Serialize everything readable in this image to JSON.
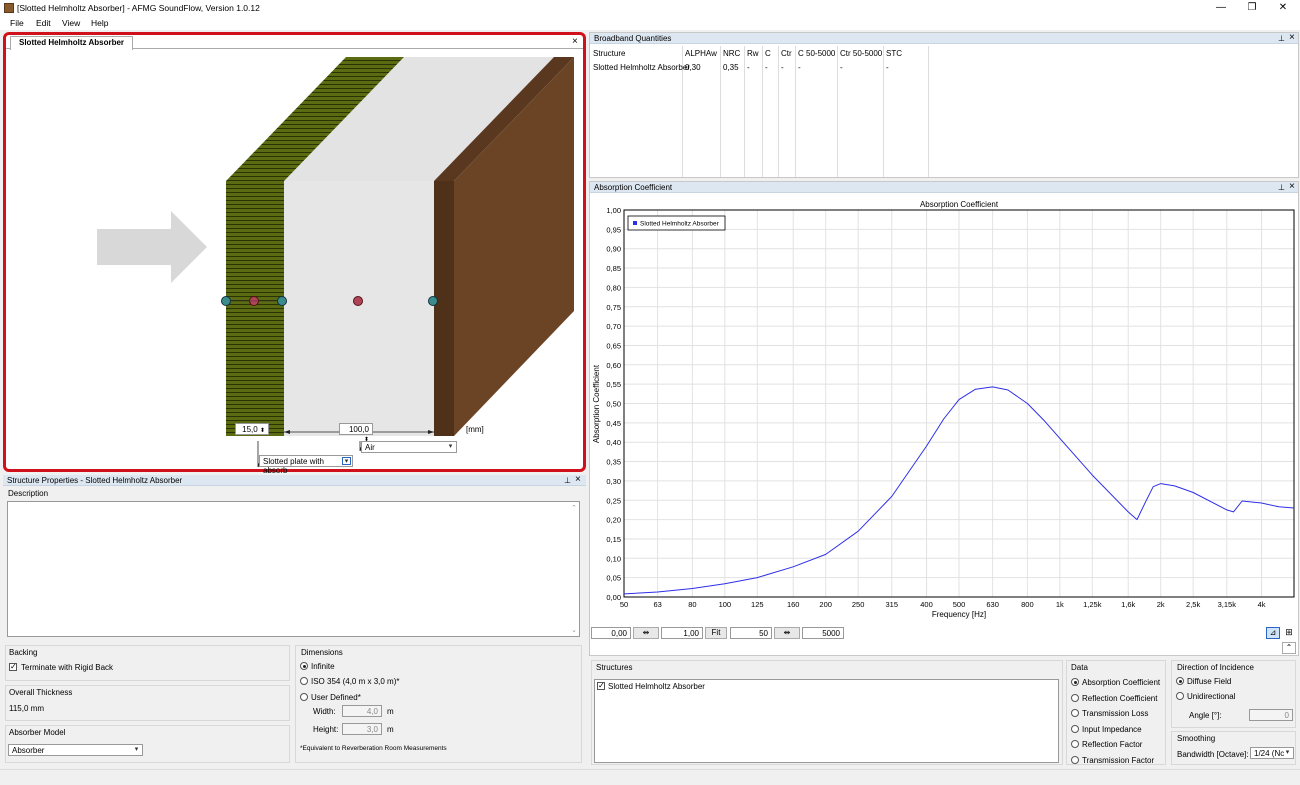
{
  "window": {
    "title": "[Slotted Helmholtz Absorber] - AFMG SoundFlow, Version 1.0.12",
    "minimize": "—",
    "restore": "❐",
    "close": "✕"
  },
  "menu": [
    "File",
    "Edit",
    "View",
    "Help"
  ],
  "editor": {
    "tab_label": "Slotted Helmholtz Absorber",
    "close": "×",
    "thickness1": "15,0",
    "thickness2": "100,0",
    "unit": "[mm]",
    "layer2_material": "Air",
    "layer1_material": "Slotted plate with absorb",
    "colors": {
      "slotted": "#5a6b12",
      "slot_lines": "#2a3306",
      "air": "#e6e6e6",
      "backing": "#6b4426",
      "backing_side": "#4f3019",
      "arrow": "#d8d8d8"
    }
  },
  "broadband": {
    "header": "Broadband Quantities",
    "columns": [
      "Structure",
      "ALPHAw",
      "NRC",
      "Rw",
      "C",
      "Ctr",
      "C 50-5000",
      "Ctr 50-5000",
      "STC"
    ],
    "rows": [
      [
        "Slotted Helmholtz Absorber",
        "0,30",
        "0,35",
        "-",
        "-",
        "-",
        "-",
        "-",
        "-"
      ]
    ]
  },
  "absorption_panel": {
    "header": "Absorption Coefficient"
  },
  "chart_data": {
    "type": "line",
    "title": "Absorption Coefficient",
    "xlabel": "Frequency [Hz]",
    "ylabel": "Absorption Coefficient",
    "xscale": "log",
    "xlim": [
      50,
      5000
    ],
    "ylim": [
      0,
      1
    ],
    "grid": true,
    "legend_position": "top-left",
    "x_ticks": [
      "50",
      "63",
      "80",
      "100",
      "125",
      "160",
      "200",
      "250",
      "315",
      "400",
      "500",
      "630",
      "800",
      "1k",
      "1,25k",
      "1,6k",
      "2k",
      "2,5k",
      "3,15k",
      "4k"
    ],
    "y_ticks": [
      "0,00",
      "0,05",
      "0,10",
      "0,15",
      "0,20",
      "0,25",
      "0,30",
      "0,35",
      "0,40",
      "0,45",
      "0,50",
      "0,55",
      "0,60",
      "0,65",
      "0,70",
      "0,75",
      "0,80",
      "0,85",
      "0,90",
      "0,95",
      "1,00"
    ],
    "series": [
      {
        "name": "Slotted Helmholtz Absorber",
        "color": "#2f2fe8",
        "x": [
          50,
          63,
          80,
          100,
          125,
          160,
          200,
          250,
          315,
          400,
          450,
          500,
          560,
          630,
          700,
          800,
          900,
          1000,
          1250,
          1600,
          1700,
          1800,
          1900,
          2000,
          2200,
          2500,
          3150,
          3300,
          3500,
          4000,
          4500,
          5000
        ],
        "y": [
          0.008,
          0.013,
          0.022,
          0.034,
          0.05,
          0.078,
          0.11,
          0.17,
          0.26,
          0.39,
          0.46,
          0.51,
          0.537,
          0.543,
          0.535,
          0.5,
          0.455,
          0.41,
          0.315,
          0.22,
          0.2,
          0.245,
          0.285,
          0.293,
          0.287,
          0.27,
          0.225,
          0.22,
          0.248,
          0.243,
          0.233,
          0.23
        ]
      }
    ]
  },
  "chart_controls": {
    "xmin": "0,00",
    "xmax": "1,00",
    "fit": "Fit",
    "fmin": "50",
    "fmax": "5000"
  },
  "structure_props": {
    "header": "Structure Properties - Slotted Helmholtz Absorber",
    "description_label": "Description",
    "backing_label": "Backing",
    "rigid_back_label": "Terminate with Rigid Back",
    "overall_label": "Overall Thickness",
    "overall_value": "115,0 mm",
    "model_label": "Absorber Model",
    "model_value": "Absorber",
    "dimensions_label": "Dimensions",
    "dim_infinite": "Infinite",
    "dim_iso": "ISO 354 (4,0 m x 3,0 m)*",
    "dim_user": "User Defined*",
    "width_label": "Width:",
    "width_value": "4,0",
    "height_label": "Height:",
    "height_value": "3,0",
    "m": "m",
    "footnote": "*Equivalent to Reverberation Room Measurements"
  },
  "bottom_right": {
    "structures_label": "Structures",
    "structures_item": "Slotted Helmholtz Absorber",
    "data_label": "Data",
    "data_options": [
      "Absorption Coefficient",
      "Reflection Coefficient",
      "Transmission Loss",
      "Input Impedance",
      "Reflection Factor",
      "Transmission Factor"
    ],
    "incidence_label": "Direction of Incidence",
    "incidence_options": [
      "Diffuse Field",
      "Unidirectional"
    ],
    "angle_label": "Angle [°]:",
    "angle_value": "0",
    "smoothing_label": "Smoothing",
    "bandwidth_label": "Bandwidth [Octave]:",
    "bandwidth_value": "1/24 (Nc"
  },
  "icons": {
    "pin": "pin-icon",
    "close": "close-icon"
  }
}
